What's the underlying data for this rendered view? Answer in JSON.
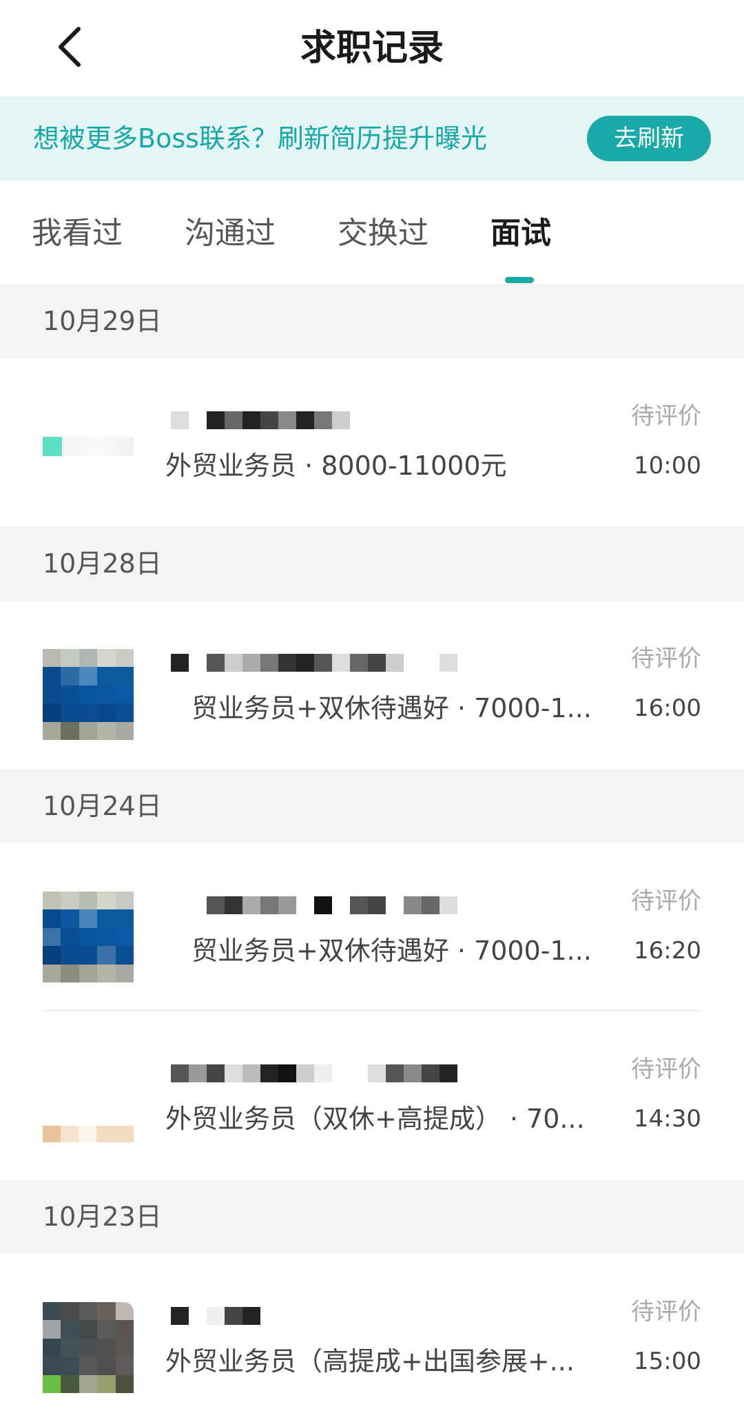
{
  "header": {
    "title": "求职记录",
    "back_icon": "chevron-left-icon"
  },
  "banner": {
    "text": "想被更多Boss联系？刷新简历提升曝光",
    "button_label": "去刷新"
  },
  "tabs": [
    {
      "label": "我看过",
      "active": false
    },
    {
      "label": "沟通过",
      "active": false
    },
    {
      "label": "交换过",
      "active": false
    },
    {
      "label": "面试",
      "active": true
    }
  ],
  "groups": [
    {
      "date": "10月29日",
      "items": [
        {
          "job": "外贸业务员 · 8000-11000元",
          "status": "待评价",
          "time": "10:00"
        }
      ]
    },
    {
      "date": "10月28日",
      "items": [
        {
          "job": "贸业务员+双休待遇好 · 7000-1...",
          "status": "待评价",
          "time": "16:00"
        }
      ]
    },
    {
      "date": "10月24日",
      "items": [
        {
          "job": "贸业务员+双休待遇好 · 7000-1...",
          "status": "待评价",
          "time": "16:20"
        },
        {
          "job": "外贸业务员（双休+高提成） · 70...",
          "status": "待评价",
          "time": "14:30"
        }
      ]
    },
    {
      "date": "10月23日",
      "items": [
        {
          "job": "外贸业务员（高提成+出国参展+...",
          "status": "待评价",
          "time": "15:00"
        }
      ]
    }
  ],
  "colors": {
    "accent": "#1aa8a8",
    "banner_bg": "#e3f5f5",
    "section_bg": "#f4f4f4"
  }
}
